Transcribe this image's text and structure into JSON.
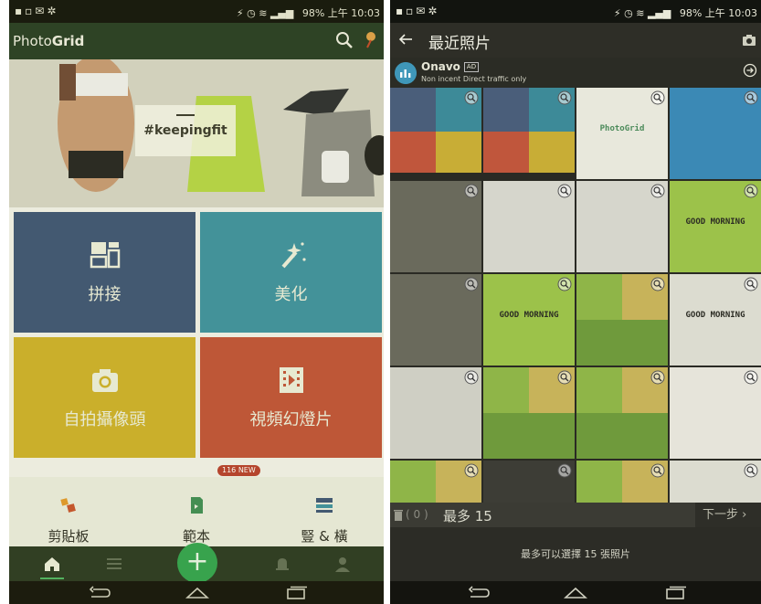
{
  "left": {
    "statusbar": {
      "time": "上午 10:03",
      "battery": "98%"
    },
    "appbar": {
      "logo_light": "Photo",
      "logo_bold": "Grid"
    },
    "hero": {
      "hashtag": "#keepingfit"
    },
    "tiles": [
      {
        "label": "拼接",
        "icon": "grid-layout-icon",
        "color": "#3e5579"
      },
      {
        "label": "美化",
        "icon": "magic-wand-icon",
        "color": "#3e93a4"
      },
      {
        "label": "自拍攝像頭",
        "icon": "camera-icon",
        "color": "#cfb22e"
      },
      {
        "label": "視頻幻燈片",
        "icon": "video-icon",
        "color": "#c2533b"
      }
    ],
    "badge": "116 NEW",
    "quick": [
      {
        "label": "剪貼板",
        "icon": "scrapbook-icon"
      },
      {
        "label": "範本",
        "icon": "template-icon"
      },
      {
        "label": "豎 & 橫",
        "icon": "layout-icon"
      }
    ],
    "fab": "+"
  },
  "right": {
    "statusbar": {
      "time": "上午 10:03",
      "battery": "98%"
    },
    "appbar": {
      "title": "最近照片"
    },
    "ad": {
      "name": "Onavo",
      "tag": "AD",
      "subtitle": "Non incent Direct traffic only"
    },
    "bottom": {
      "count": "( 0 )",
      "max_label": "最多 15",
      "next_label": "下一步 ›"
    },
    "hint": "最多可以選擇 15 張照片",
    "photos": [
      {
        "kind": "gridui",
        "text": ""
      },
      {
        "kind": "gridui",
        "text": ""
      },
      {
        "kind": "logo",
        "text": "PhotoGrid"
      },
      {
        "kind": "icons",
        "text": ""
      },
      {
        "kind": "dialog",
        "text": ""
      },
      {
        "kind": "phoneicons",
        "text": ""
      },
      {
        "kind": "phoneicons",
        "text": ""
      },
      {
        "kind": "goodmorning",
        "text": "GOOD MORNING"
      },
      {
        "kind": "dialog",
        "text": ""
      },
      {
        "kind": "goodmorning",
        "text": "GOOD MORNING"
      },
      {
        "kind": "collage",
        "text": ""
      },
      {
        "kind": "plain",
        "text": "GOOD MORNING"
      },
      {
        "kind": "keyboard",
        "text": ""
      },
      {
        "kind": "collage",
        "text": ""
      },
      {
        "kind": "collage",
        "text": ""
      },
      {
        "kind": "stickers",
        "text": ""
      },
      {
        "kind": "collage",
        "text": ""
      },
      {
        "kind": "dark",
        "text": ""
      },
      {
        "kind": "collage",
        "text": ""
      },
      {
        "kind": "plain",
        "text": ""
      }
    ]
  },
  "colors": {
    "accent": "#32a552",
    "appbar": "#273e27"
  }
}
